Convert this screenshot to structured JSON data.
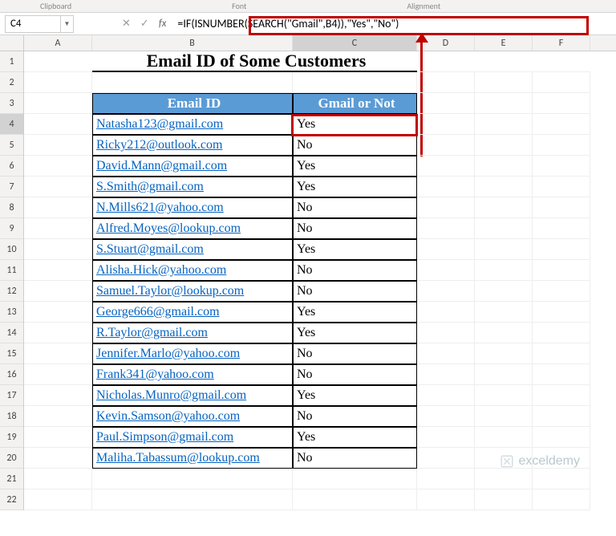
{
  "ribbon": {
    "group1": "Clipboard",
    "group2": "Font",
    "group3": "Alignment"
  },
  "name_box": {
    "value": "C4"
  },
  "formula_bar": {
    "fx": "fx",
    "formula": "=IF(ISNUMBER(SEARCH(\"Gmail\",B4)),\"Yes\",\"No\")"
  },
  "columns": [
    "A",
    "B",
    "C",
    "D",
    "E",
    "F"
  ],
  "title": "Email ID of Some Customers",
  "headers": {
    "b": "Email ID",
    "c": "Gmail or Not"
  },
  "rows": [
    {
      "email": "Natasha123@gmail.com",
      "result": "Yes"
    },
    {
      "email": "Ricky212@outlook.com",
      "result": "No"
    },
    {
      "email": "David.Mann@gmail.com",
      "result": "Yes"
    },
    {
      "email": "S.Smith@gmail.com",
      "result": "Yes"
    },
    {
      "email": "N.Mills621@yahoo.com",
      "result": "No"
    },
    {
      "email": "Alfred.Moyes@lookup.com",
      "result": "No"
    },
    {
      "email": "S.Stuart@gmail.com",
      "result": "Yes"
    },
    {
      "email": "Alisha.Hick@yahoo.com",
      "result": "No"
    },
    {
      "email": "Samuel.Taylor@lookup.com",
      "result": "No"
    },
    {
      "email": "George666@gmail.com",
      "result": "Yes"
    },
    {
      "email": "R.Taylor@gmail.com",
      "result": "Yes"
    },
    {
      "email": "Jennifer.Marlo@yahoo.com",
      "result": "No"
    },
    {
      "email": "Frank341@yahoo.com",
      "result": "No"
    },
    {
      "email": "Nicholas.Munro@gmail.com",
      "result": "Yes"
    },
    {
      "email": "Kevin.Samson@yahoo.com",
      "result": "No"
    },
    {
      "email": "Paul.Simpson@gmail.com",
      "result": "Yes"
    },
    {
      "email": "Maliha.Tabassum@lookup.com",
      "result": "No"
    }
  ],
  "row_labels": [
    "1",
    "2",
    "3",
    "4",
    "5",
    "6",
    "7",
    "8",
    "9",
    "10",
    "11",
    "12",
    "13",
    "14",
    "15",
    "16",
    "17",
    "18",
    "19",
    "20",
    "21",
    "22"
  ],
  "watermark": "exceldemy"
}
